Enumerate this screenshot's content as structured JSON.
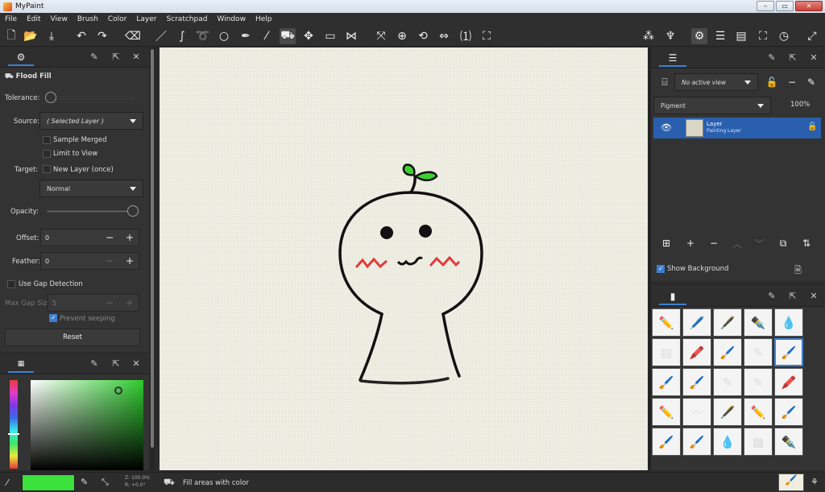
{
  "window": {
    "title": "MyPaint",
    "controls": [
      "–",
      "▭",
      "✕"
    ]
  },
  "menu": [
    "File",
    "Edit",
    "View",
    "Brush",
    "Color",
    "Layer",
    "Scratchpad",
    "Window",
    "Help"
  ],
  "toolbar_icons": [
    "new-file-icon",
    "open-icon",
    "save-icon",
    "undo-icon",
    "redo-icon",
    "eraser-icon",
    "brush-icon",
    "inking-icon",
    "lasso-icon",
    "ellipse-icon",
    "pen-icon",
    "color-picker-icon",
    "flood-fill-icon",
    "move-layer-icon",
    "frame-icon",
    "symmetry-icon",
    "pan-icon",
    "zoom-icon",
    "rotate-icon",
    "mirror-icon",
    "zoom-reset-icon",
    "fit-icon",
    "color-history-icon",
    "brush-history-icon",
    "settings-icon",
    "menu-icon",
    "scratchpad-icon",
    "fullscreen-icon",
    "time-icon",
    "expand-icon"
  ],
  "tool_options": {
    "tool_name": "Flood Fill",
    "tolerance_label": "Tolerance:",
    "tolerance_value": 0.05,
    "source_label": "Source:",
    "source_value": "( Selected Layer )",
    "sample_merged": {
      "label": "Sample Merged",
      "checked": false
    },
    "limit_to_view": {
      "label": "Limit to View",
      "checked": false
    },
    "target_label": "Target:",
    "new_layer": {
      "label": "New Layer (once)",
      "checked": false
    },
    "blend_mode": "Normal",
    "opacity_label": "Opacity:",
    "opacity_value": 1.0,
    "offset_label": "Offset:",
    "offset_value": "0",
    "feather_label": "Feather:",
    "feather_value": "0",
    "gap_detection": {
      "label": "Use Gap Detection",
      "checked": false
    },
    "max_gap_label": "Max Gap Size:",
    "max_gap_value": "5",
    "prevent_seeping": {
      "label": "Prevent seeping",
      "checked": true
    },
    "reset_label": "Reset"
  },
  "layers": {
    "view_label": "No active view",
    "mode": "Pigment",
    "opacity": "100%",
    "layer_name": "Layer",
    "layer_type": "Painting Layer",
    "show_background": {
      "label": "Show Background",
      "checked": true
    }
  },
  "color": {
    "current": "#3be03b",
    "accent": "#3d7ed0"
  },
  "status": {
    "zoom": "Z: 100.0%",
    "rotation": "R: +0.0°",
    "message": "Fill areas with color"
  }
}
